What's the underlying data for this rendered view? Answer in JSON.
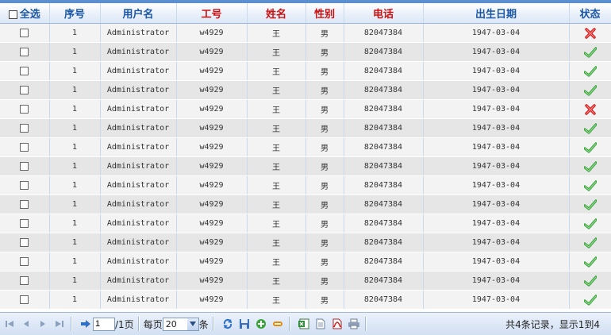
{
  "header": {
    "select_all": "全选",
    "cols": [
      "序号",
      "用户名",
      "工号",
      "姓名",
      "性别",
      "电话",
      "出生日期",
      "状态"
    ]
  },
  "rows": [
    {
      "idx": "1",
      "username": "Administrator",
      "empno": "w4929",
      "name": "王",
      "gender": "男",
      "phone": "82047384",
      "birth": "1947-03-04",
      "status": "inactive"
    },
    {
      "idx": "1",
      "username": "Administrator",
      "empno": "w4929",
      "name": "王",
      "gender": "男",
      "phone": "82047384",
      "birth": "1947-03-04",
      "status": "active"
    },
    {
      "idx": "1",
      "username": "Administrator",
      "empno": "w4929",
      "name": "王",
      "gender": "男",
      "phone": "82047384",
      "birth": "1947-03-04",
      "status": "active"
    },
    {
      "idx": "1",
      "username": "Administrator",
      "empno": "w4929",
      "name": "王",
      "gender": "男",
      "phone": "82047384",
      "birth": "1947-03-04",
      "status": "active"
    },
    {
      "idx": "1",
      "username": "Administrator",
      "empno": "w4929",
      "name": "王",
      "gender": "男",
      "phone": "82047384",
      "birth": "1947-03-04",
      "status": "inactive"
    },
    {
      "idx": "1",
      "username": "Administrator",
      "empno": "w4929",
      "name": "王",
      "gender": "男",
      "phone": "82047384",
      "birth": "1947-03-04",
      "status": "active"
    },
    {
      "idx": "1",
      "username": "Administrator",
      "empno": "w4929",
      "name": "王",
      "gender": "男",
      "phone": "82047384",
      "birth": "1947-03-04",
      "status": "active"
    },
    {
      "idx": "1",
      "username": "Administrator",
      "empno": "w4929",
      "name": "王",
      "gender": "男",
      "phone": "82047384",
      "birth": "1947-03-04",
      "status": "active"
    },
    {
      "idx": "1",
      "username": "Administrator",
      "empno": "w4929",
      "name": "王",
      "gender": "男",
      "phone": "82047384",
      "birth": "1947-03-04",
      "status": "active"
    },
    {
      "idx": "1",
      "username": "Administrator",
      "empno": "w4929",
      "name": "王",
      "gender": "男",
      "phone": "82047384",
      "birth": "1947-03-04",
      "status": "active"
    },
    {
      "idx": "1",
      "username": "Administrator",
      "empno": "w4929",
      "name": "王",
      "gender": "男",
      "phone": "82047384",
      "birth": "1947-03-04",
      "status": "active"
    },
    {
      "idx": "1",
      "username": "Administrator",
      "empno": "w4929",
      "name": "王",
      "gender": "男",
      "phone": "82047384",
      "birth": "1947-03-04",
      "status": "active"
    },
    {
      "idx": "1",
      "username": "Administrator",
      "empno": "w4929",
      "name": "王",
      "gender": "男",
      "phone": "82047384",
      "birth": "1947-03-04",
      "status": "active"
    },
    {
      "idx": "1",
      "username": "Administrator",
      "empno": "w4929",
      "name": "王",
      "gender": "男",
      "phone": "82047384",
      "birth": "1947-03-04",
      "status": "active"
    },
    {
      "idx": "1",
      "username": "Administrator",
      "empno": "w4929",
      "name": "王",
      "gender": "男",
      "phone": "82047384",
      "birth": "1947-03-04",
      "status": "active"
    }
  ],
  "pager": {
    "page_value": "1",
    "page_total_label": "/1页",
    "per_page_label": "每页",
    "per_page_value": "20",
    "unit_label": "条",
    "info": "共4条记录，显示1到4"
  },
  "icons": {
    "first": "first-page-icon",
    "prev": "prev-page-icon",
    "next": "next-page-icon",
    "last": "last-page-icon",
    "go": "go-arrow-icon",
    "refresh": "refresh-icon",
    "save": "save-icon",
    "add": "add-icon",
    "remove": "remove-icon",
    "excel": "excel-export-icon",
    "doc": "document-export-icon",
    "pdf": "pdf-export-icon",
    "print": "print-icon",
    "status_active": "check-icon",
    "status_inactive": "cross-icon"
  },
  "colors": {
    "header_blue": "#1b57a6",
    "header_red": "#cc1010",
    "check": "#3aa53a",
    "cross": "#d92020"
  }
}
